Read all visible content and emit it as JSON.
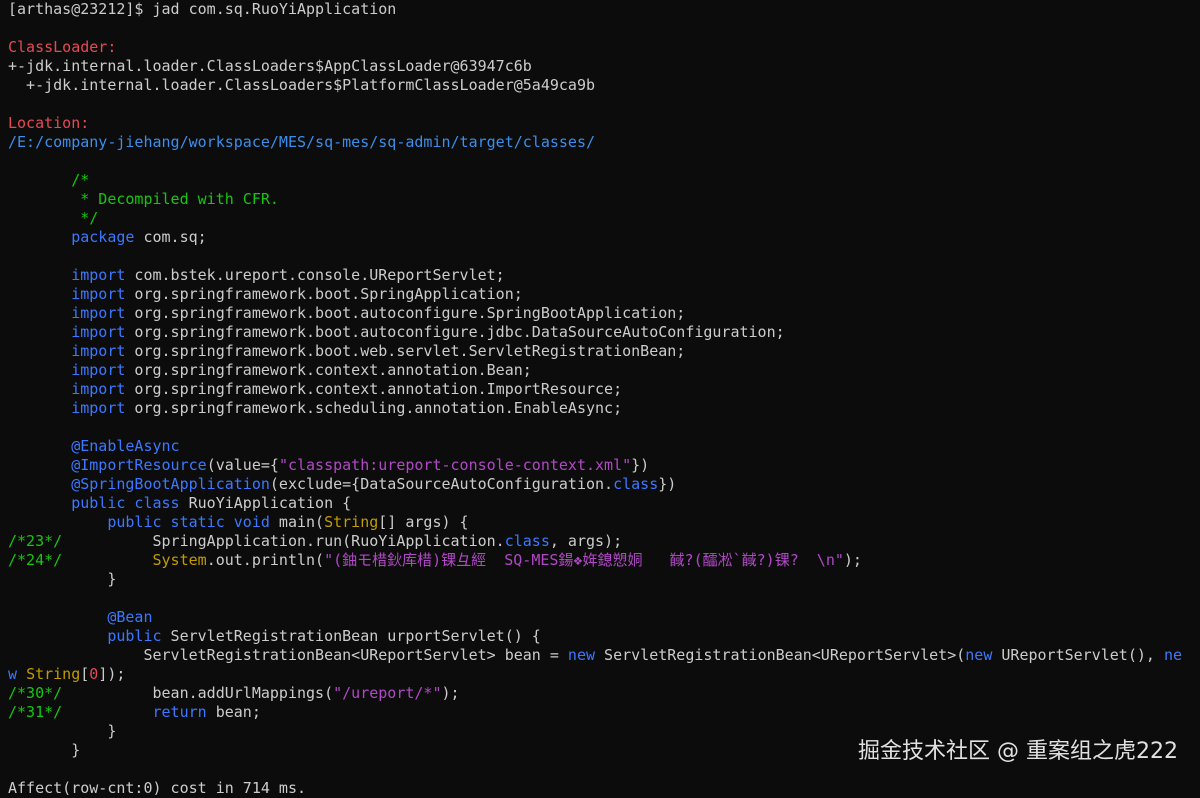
{
  "terminal": {
    "lines": [
      [
        {
          "t": "[arthas@23212]$ jad com.sq.RuoYiApplication",
          "c": "prompt"
        }
      ],
      [],
      [
        {
          "t": "ClassLoader:",
          "c": "label"
        }
      ],
      [
        {
          "t": "+-jdk.internal.loader.ClassLoaders$AppClassLoader@63947c6b",
          "c": "plain"
        }
      ],
      [
        {
          "t": "  +-jdk.internal.loader.ClassLoaders$PlatformClassLoader@5a49ca9b",
          "c": "plain"
        }
      ],
      [],
      [
        {
          "t": "Location:",
          "c": "label"
        }
      ],
      [
        {
          "t": "/E:/company-jiehang/workspace/MES/sq-mes/sq-admin/target/classes/",
          "c": "path"
        }
      ],
      [],
      [
        {
          "t": "       /*",
          "c": "comment"
        }
      ],
      [
        {
          "t": "        * Decompiled with CFR.",
          "c": "comment"
        }
      ],
      [
        {
          "t": "        */",
          "c": "comment"
        }
      ],
      [
        {
          "t": "       ",
          "c": "plain"
        },
        {
          "t": "package",
          "c": "kw"
        },
        {
          "t": " com.sq;",
          "c": "plain"
        }
      ],
      [],
      [
        {
          "t": "       ",
          "c": "plain"
        },
        {
          "t": "import",
          "c": "kw"
        },
        {
          "t": " com.bstek.ureport.console.UReportServlet;",
          "c": "plain"
        }
      ],
      [
        {
          "t": "       ",
          "c": "plain"
        },
        {
          "t": "import",
          "c": "kw"
        },
        {
          "t": " org.springframework.boot.SpringApplication;",
          "c": "plain"
        }
      ],
      [
        {
          "t": "       ",
          "c": "plain"
        },
        {
          "t": "import",
          "c": "kw"
        },
        {
          "t": " org.springframework.boot.autoconfigure.SpringBootApplication;",
          "c": "plain"
        }
      ],
      [
        {
          "t": "       ",
          "c": "plain"
        },
        {
          "t": "import",
          "c": "kw"
        },
        {
          "t": " org.springframework.boot.autoconfigure.jdbc.DataSourceAutoConfiguration;",
          "c": "plain"
        }
      ],
      [
        {
          "t": "       ",
          "c": "plain"
        },
        {
          "t": "import",
          "c": "kw"
        },
        {
          "t": " org.springframework.boot.web.servlet.ServletRegistrationBean;",
          "c": "plain"
        }
      ],
      [
        {
          "t": "       ",
          "c": "plain"
        },
        {
          "t": "import",
          "c": "kw"
        },
        {
          "t": " org.springframework.context.annotation.Bean;",
          "c": "plain"
        }
      ],
      [
        {
          "t": "       ",
          "c": "plain"
        },
        {
          "t": "import",
          "c": "kw"
        },
        {
          "t": " org.springframework.context.annotation.ImportResource;",
          "c": "plain"
        }
      ],
      [
        {
          "t": "       ",
          "c": "plain"
        },
        {
          "t": "import",
          "c": "kw"
        },
        {
          "t": " org.springframework.scheduling.annotation.EnableAsync;",
          "c": "plain"
        }
      ],
      [],
      [
        {
          "t": "       ",
          "c": "plain"
        },
        {
          "t": "@EnableAsync",
          "c": "ann"
        }
      ],
      [
        {
          "t": "       ",
          "c": "plain"
        },
        {
          "t": "@ImportResource",
          "c": "ann"
        },
        {
          "t": "(value={",
          "c": "plain"
        },
        {
          "t": "\"classpath:ureport-console-context.xml\"",
          "c": "str"
        },
        {
          "t": "})",
          "c": "plain"
        }
      ],
      [
        {
          "t": "       ",
          "c": "plain"
        },
        {
          "t": "@SpringBootApplication",
          "c": "ann"
        },
        {
          "t": "(exclude={DataSourceAutoConfiguration.",
          "c": "plain"
        },
        {
          "t": "class",
          "c": "kw"
        },
        {
          "t": "})",
          "c": "plain"
        }
      ],
      [
        {
          "t": "       ",
          "c": "plain"
        },
        {
          "t": "public class",
          "c": "kw"
        },
        {
          "t": " RuoYiApplication {",
          "c": "plain"
        }
      ],
      [
        {
          "t": "           ",
          "c": "plain"
        },
        {
          "t": "public static void",
          "c": "kw"
        },
        {
          "t": " main(",
          "c": "plain"
        },
        {
          "t": "String",
          "c": "type"
        },
        {
          "t": "[] args) {",
          "c": "plain"
        }
      ],
      [
        {
          "t": "/*23*/",
          "c": "comment"
        },
        {
          "t": "          SpringApplication.run(RuoYiApplication.",
          "c": "plain"
        },
        {
          "t": "class",
          "c": "kw"
        },
        {
          "t": ", args);",
          "c": "plain"
        }
      ],
      [
        {
          "t": "/*24*/",
          "c": "comment"
        },
        {
          "t": "          ",
          "c": "plain"
        },
        {
          "t": "System",
          "c": "type"
        },
        {
          "t": ".out.println(",
          "c": "plain"
        },
        {
          "t": "\"(鈾モ棤鈥库棤)锞彑經  SQ-MES鍚❖姩鎴愬姛   馘?(醽凇`馘?)锞?  \\n\"",
          "c": "str"
        },
        {
          "t": ");",
          "c": "plain"
        }
      ],
      [
        {
          "t": "           }",
          "c": "plain"
        }
      ],
      [],
      [
        {
          "t": "           ",
          "c": "plain"
        },
        {
          "t": "@Bean",
          "c": "ann"
        }
      ],
      [
        {
          "t": "           ",
          "c": "plain"
        },
        {
          "t": "public",
          "c": "kw"
        },
        {
          "t": " ServletRegistrationBean urportServlet() {",
          "c": "plain"
        }
      ],
      [
        {
          "t": "               ServletRegistrationBean<UReportServlet> bean = ",
          "c": "plain"
        },
        {
          "t": "new",
          "c": "kw"
        },
        {
          "t": " ServletRegistrationBean<UReportServlet>(",
          "c": "plain"
        },
        {
          "t": "new",
          "c": "kw"
        },
        {
          "t": " UReportServlet(), ",
          "c": "plain"
        },
        {
          "t": "ne",
          "c": "kw"
        }
      ],
      [
        {
          "t": "w",
          "c": "kw"
        },
        {
          "t": " ",
          "c": "plain"
        },
        {
          "t": "String",
          "c": "type"
        },
        {
          "t": "[",
          "c": "plain"
        },
        {
          "t": "0",
          "c": "num"
        },
        {
          "t": "]);",
          "c": "plain"
        }
      ],
      [
        {
          "t": "/*30*/",
          "c": "comment"
        },
        {
          "t": "          bean.addUrlMappings(",
          "c": "plain"
        },
        {
          "t": "\"/ureport/*\"",
          "c": "str"
        },
        {
          "t": ");",
          "c": "plain"
        }
      ],
      [
        {
          "t": "/*31*/",
          "c": "comment"
        },
        {
          "t": "          ",
          "c": "plain"
        },
        {
          "t": "return",
          "c": "kw"
        },
        {
          "t": " bean;",
          "c": "plain"
        }
      ],
      [
        {
          "t": "           }",
          "c": "plain"
        }
      ],
      [
        {
          "t": "       }",
          "c": "plain"
        }
      ],
      [],
      [
        {
          "t": "Affect(row-cnt:0) cost in 714 ms.",
          "c": "plain"
        }
      ]
    ]
  },
  "watermark": "掘金技术社区 @ 重案组之虎222"
}
